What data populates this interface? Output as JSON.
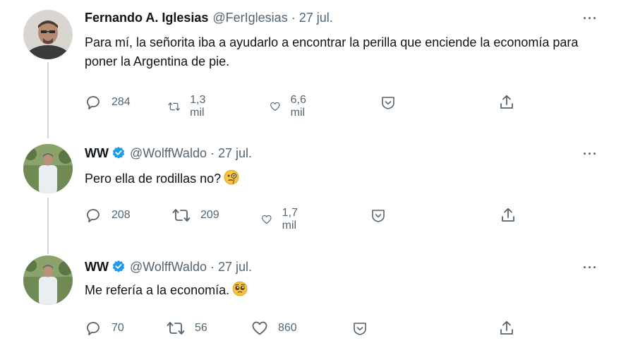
{
  "tweets": [
    {
      "author_name": "Fernando A. Iglesias",
      "handle": "@FerIglesias",
      "separator": "·",
      "date": "27 jul.",
      "verified": false,
      "text": "Para mí, la señorita iba a ayudarlo a encontrar la perilla que enciende la economía para poner la Argentina de pie.",
      "replies": "284",
      "retweets": "1,3 mil",
      "likes": "6,6 mil",
      "more": "···"
    },
    {
      "author_name": "WW",
      "handle": "@WolffWaldo",
      "separator": "·",
      "date": "27 jul.",
      "verified": true,
      "text": "Pero ella de rodillas no?",
      "emoji": "face-with-monocle",
      "replies": "208",
      "retweets": "209",
      "likes": "1,7 mil",
      "more": "···"
    },
    {
      "author_name": "WW",
      "handle": "@WolffWaldo",
      "separator": "·",
      "date": "27 jul.",
      "verified": true,
      "text": "Me refería a la economía.",
      "emoji": "pleading-face",
      "replies": "70",
      "retweets": "56",
      "likes": "860",
      "more": "···"
    }
  ],
  "colors": {
    "text": "#0f1419",
    "secondary": "#536471",
    "verified": "#1d9bf0",
    "thread_line": "#cfd9de"
  }
}
